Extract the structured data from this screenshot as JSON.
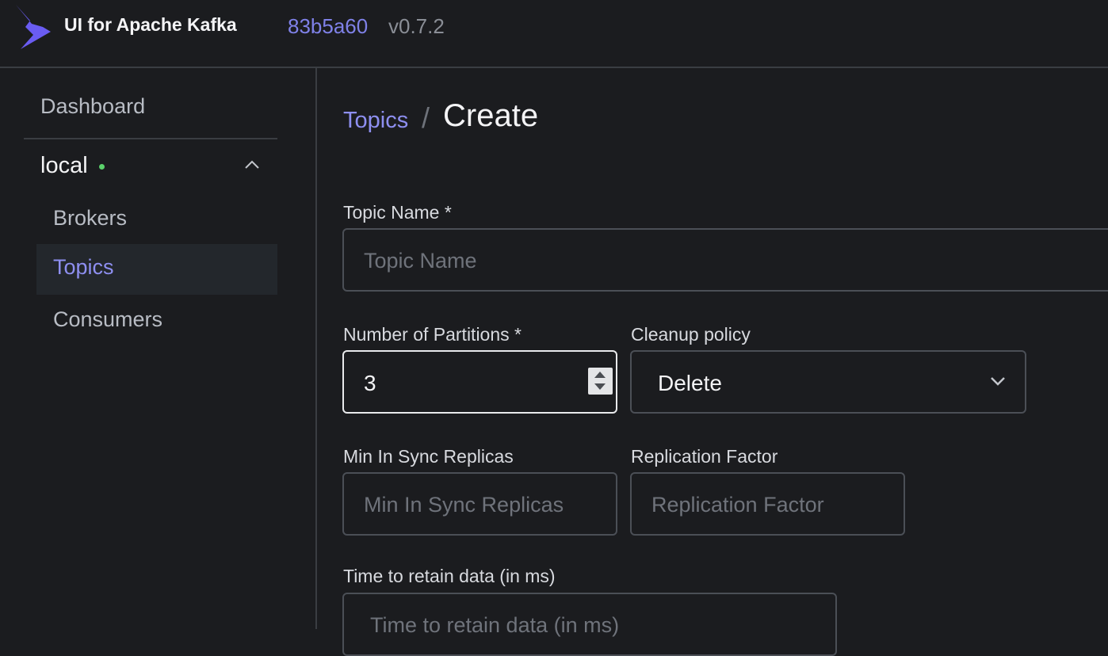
{
  "header": {
    "app_title": "UI for Apache Kafka",
    "commit": "83b5a60",
    "version": "v0.7.2",
    "logo_icon": "kafka-ui-logo",
    "accent_color": "#7f81e8"
  },
  "sidebar": {
    "dashboard_label": "Dashboard",
    "cluster": {
      "name": "local",
      "status_color": "#5bd16b",
      "expanded": true
    },
    "items": [
      {
        "label": "Brokers",
        "active": false
      },
      {
        "label": "Topics",
        "active": true
      },
      {
        "label": "Consumers",
        "active": false
      }
    ]
  },
  "breadcrumb": {
    "parent": "Topics",
    "separator": "/",
    "current": "Create"
  },
  "form": {
    "topic_name": {
      "label": "Topic Name *",
      "placeholder": "Topic Name",
      "value": ""
    },
    "partitions": {
      "label": "Number of Partitions *",
      "value": "3"
    },
    "cleanup_policy": {
      "label": "Cleanup policy",
      "selected": "Delete"
    },
    "min_in_sync": {
      "label": "Min In Sync Replicas",
      "placeholder": "Min In Sync Replicas"
    },
    "replication_factor": {
      "label": "Replication Factor",
      "placeholder": "Replication Factor"
    },
    "retention": {
      "label": "Time to retain data (in ms)",
      "placeholder": "Time to retain data (in ms)"
    }
  }
}
